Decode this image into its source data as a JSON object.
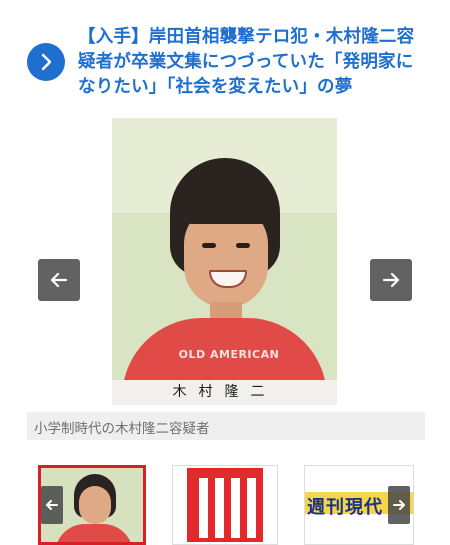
{
  "article": {
    "headline": "【入手】岸田首相襲撃テロ犯・木村隆二容疑者が卒業文集につづっていた「発明家になりたい」「社会を変えたい」の夢"
  },
  "gallery": {
    "name_plate": "木村隆二",
    "shirt_print": "OLD AMERICAN",
    "caption": "小学制時代の木村隆二容疑者",
    "thumbnails": [
      {
        "id": "thumb-1",
        "selected": true
      },
      {
        "id": "thumb-2",
        "selected": false
      },
      {
        "id": "thumb-3",
        "selected": false,
        "text": "週刊現代"
      }
    ]
  },
  "icons": {
    "headline_arrow": "chevron-right-icon",
    "prev": "arrow-left-icon",
    "next": "arrow-right-icon"
  },
  "colors": {
    "accent_blue": "#1f6fd0",
    "selected_border": "#d81e27",
    "nav_button": "#464646"
  }
}
